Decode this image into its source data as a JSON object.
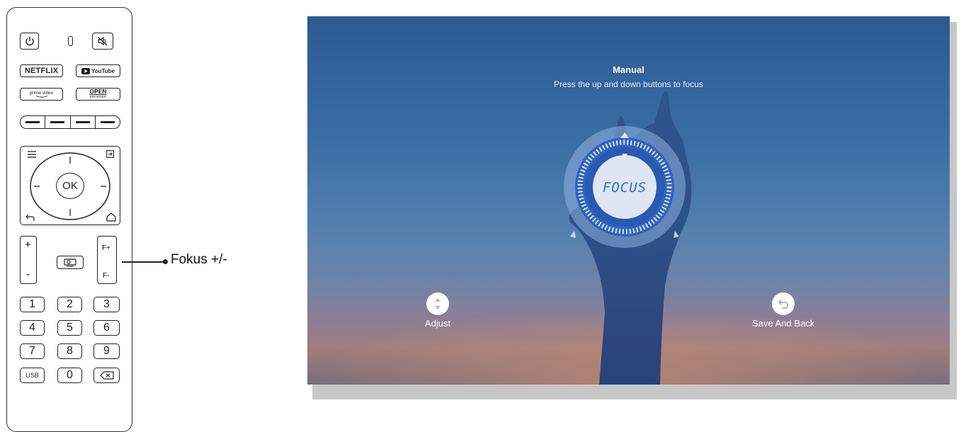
{
  "remote": {
    "buttons": {
      "power_icon": "power-icon",
      "led_icon": "indicator-led-icon",
      "mute_icon": "mute-icon",
      "netflix": "NETFLIX",
      "youtube": "YouTube",
      "prime": "prime video",
      "open": "OPEN",
      "open_sub": "BROWSER",
      "ok": "OK",
      "vol_plus": "+",
      "vol_minus": "-",
      "focus_plus": "F+",
      "focus_minus": "F-",
      "digits": [
        "1",
        "2",
        "3",
        "4",
        "5",
        "6",
        "7",
        "8",
        "9"
      ],
      "usb": "USB",
      "zero": "0"
    },
    "callout_label": "Fokus +/-"
  },
  "screen": {
    "title": "Manual",
    "subtitle": "Press the up and down buttons to focus",
    "dial_label": "FOCUS",
    "adjust_label": "Adjust",
    "save_label": "Save And Back",
    "colors": {
      "accent": "#2f6fd6",
      "sky_top": "#2b5a91",
      "sky_bottom": "#a07e7e"
    }
  }
}
